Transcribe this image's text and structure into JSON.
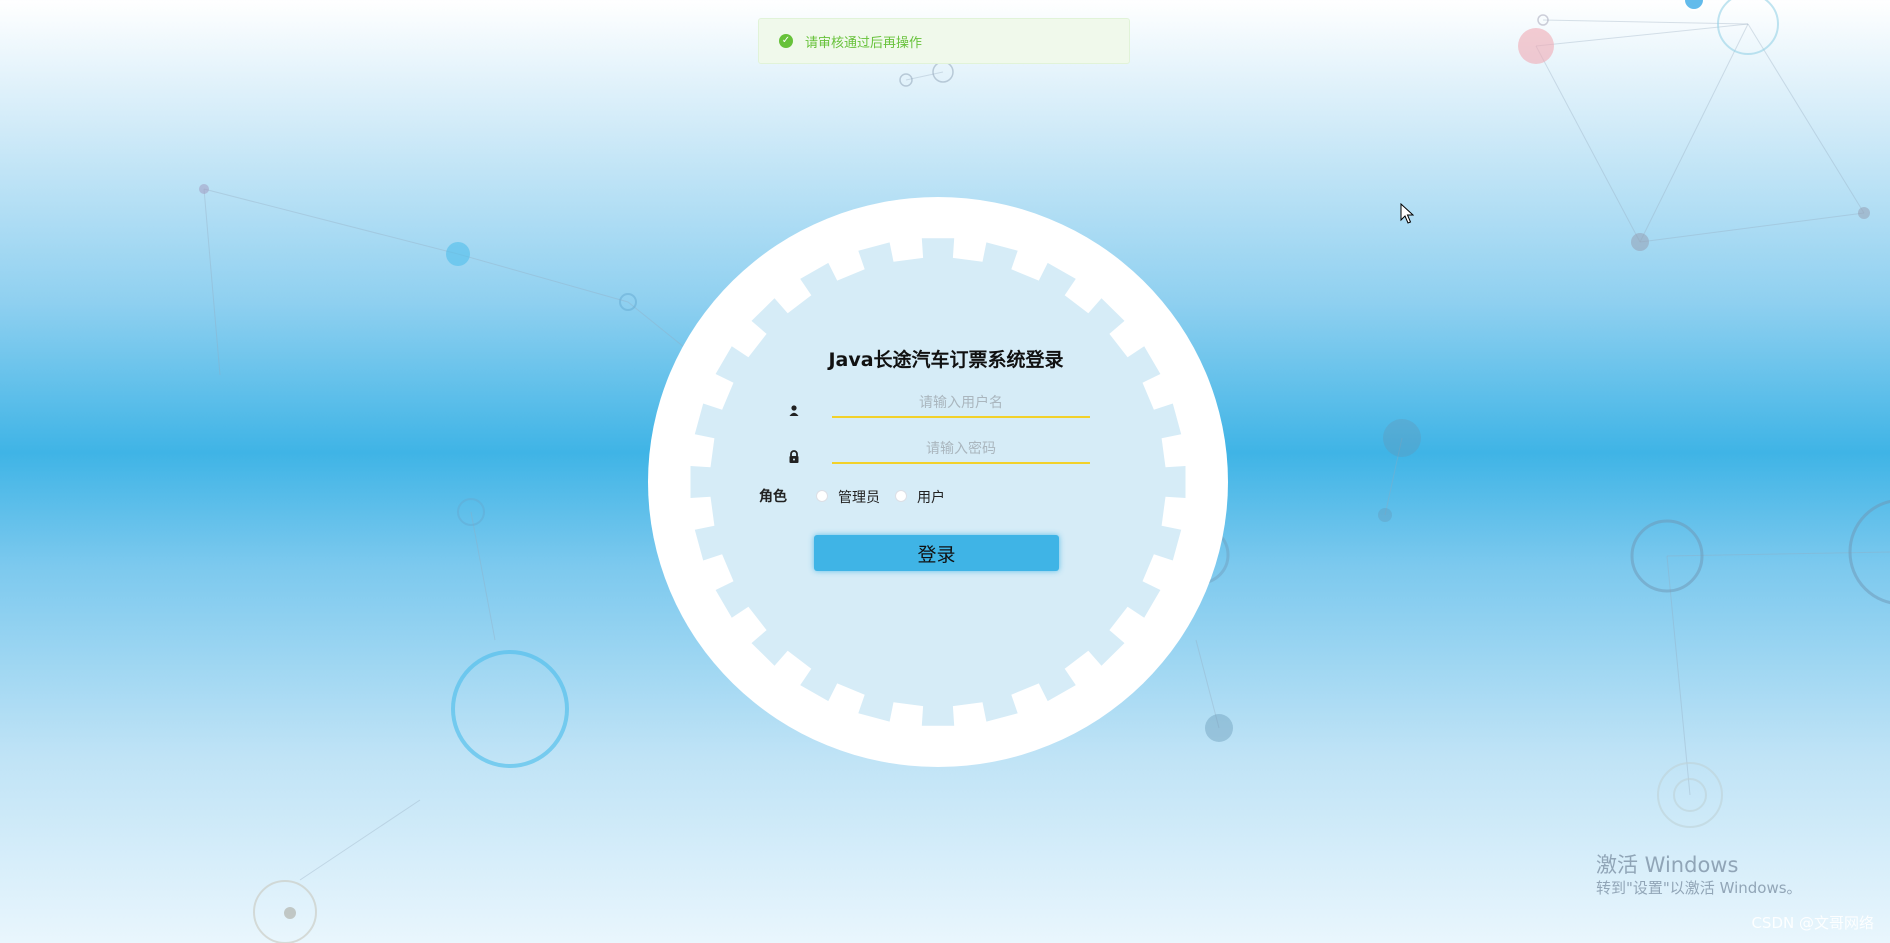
{
  "toast": {
    "icon": "check-icon",
    "message": "请审核通过后再操作",
    "color": "#67c23a"
  },
  "login": {
    "title": "Java长途汽车订票系统登录",
    "username_placeholder": "请输入用户名",
    "password_placeholder": "请输入密码",
    "role_label": "角色",
    "roles": [
      "管理员",
      "用户"
    ],
    "submit_label": "登录"
  },
  "watermark": {
    "title": "激活 Windows",
    "subtitle": "转到\"设置\"以激活 Windows。"
  },
  "attribution": "CSDN @文哥网络",
  "colors": {
    "accent": "#3fb4e6",
    "underline": "#f2d12a",
    "gear": "#ffffff",
    "panel": "#d6ecf7"
  }
}
